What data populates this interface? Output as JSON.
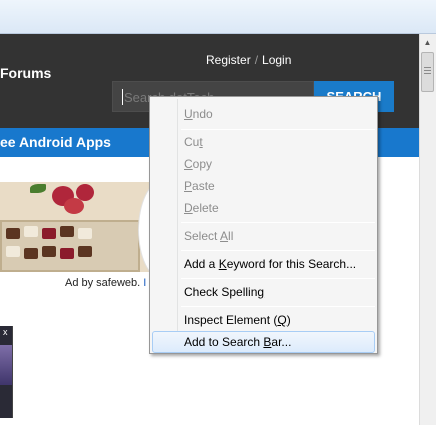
{
  "site": {
    "forums_label": "Forums",
    "register_label": "Register",
    "login_separator": "/",
    "login_label": "Login",
    "search_placeholder": "Search dotTech",
    "search_button": "SEARCH",
    "nav_label": "ee Android Apps"
  },
  "ad": {
    "caption_prefix": "Ad by safeweb. ",
    "caption_link": "I"
  },
  "thumbnail": {
    "close_glyph": "x"
  },
  "scrollbar": {
    "up_glyph": "▲"
  },
  "context_menu": {
    "items": [
      {
        "pre": "",
        "key": "U",
        "post": "ndo",
        "enabled": false
      },
      {
        "pre": "Cu",
        "key": "t",
        "post": "",
        "enabled": false
      },
      {
        "pre": "",
        "key": "C",
        "post": "opy",
        "enabled": false
      },
      {
        "pre": "",
        "key": "P",
        "post": "aste",
        "enabled": false
      },
      {
        "pre": "",
        "key": "D",
        "post": "elete",
        "enabled": false
      },
      {
        "pre": "Select ",
        "key": "A",
        "post": "ll",
        "enabled": false
      },
      {
        "pre": "Add a ",
        "key": "K",
        "post": "eyword for this Search...",
        "enabled": true
      },
      {
        "pre": "Check Spellin",
        "key": "g",
        "post": "",
        "enabled": true
      },
      {
        "pre": "Inspect Element (",
        "key": "Q",
        "post": ")",
        "enabled": true
      },
      {
        "pre": "Add to Search ",
        "key": "B",
        "post": "ar...",
        "enabled": true,
        "highlighted": true
      }
    ]
  },
  "colors": {
    "header_bg": "#333333",
    "nav_blue": "#1878cd",
    "search_button_blue": "#1a7bc9",
    "menu_bg": "#f5f5f5",
    "menu_hover_border": "#a8cdf5"
  }
}
